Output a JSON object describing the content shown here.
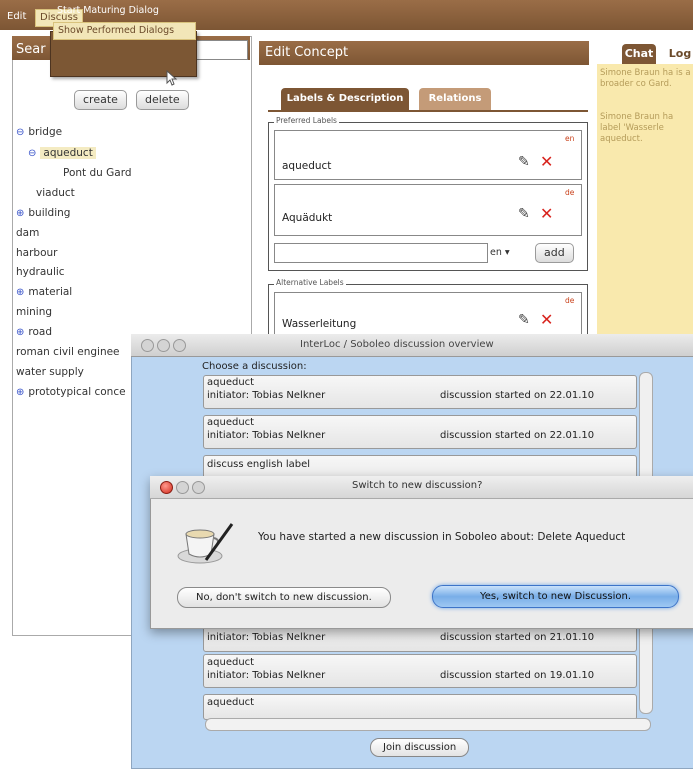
{
  "menubar": {
    "edit_label": "Edit",
    "discuss_label": "Discuss"
  },
  "discuss_menu": {
    "items": [
      "Start Maturing Dialog",
      "Show Performed Dialogs"
    ]
  },
  "left_panel": {
    "header_label": "Sear",
    "create_label": "create",
    "delete_label": "delete",
    "tree": [
      {
        "label": "bridge",
        "icon": "minus"
      },
      {
        "label": "aqueduct",
        "icon": "minus"
      },
      {
        "label": "Pont du Gard",
        "icon": ""
      },
      {
        "label": "viaduct",
        "icon": ""
      },
      {
        "label": "building",
        "icon": "plus"
      },
      {
        "label": "dam",
        "icon": ""
      },
      {
        "label": "harbour",
        "icon": ""
      },
      {
        "label": "hydraulic",
        "icon": ""
      },
      {
        "label": "material",
        "icon": "plus"
      },
      {
        "label": "mining",
        "icon": ""
      },
      {
        "label": "road",
        "icon": "plus"
      },
      {
        "label": "roman civil enginee",
        "icon": ""
      },
      {
        "label": "water supply",
        "icon": ""
      },
      {
        "label": "prototypical conce",
        "icon": "plus"
      }
    ]
  },
  "edit_concept": {
    "title": "Edit Concept",
    "tabs": [
      "Labels & Description",
      "Relations"
    ],
    "preferred_legend": "Preferred Labels",
    "preferred_labels": [
      {
        "lang": "en",
        "text": "aqueduct"
      },
      {
        "lang": "de",
        "text": "Aquädukt"
      }
    ],
    "new_label_lang": "en",
    "add_label": "add",
    "alternative_legend": "Alternative Labels",
    "alternative_labels": [
      {
        "lang": "de",
        "text": "Wasserleitung"
      }
    ]
  },
  "right_panel": {
    "tabs": [
      "Chat",
      "Log"
    ],
    "messages": [
      "Simone Braun ha is a broader co Gard.",
      "Simone Braun ha label 'Wasserle aqueduct."
    ]
  },
  "interloc": {
    "title": "InterLoc / Soboleo discussion overview",
    "choose_label": "Choose a discussion:",
    "discussions": [
      {
        "topic": "aqueduct",
        "initiator": "initiator: Tobias Nelkner",
        "started": "discussion started on 22.01.10"
      },
      {
        "topic": "aqueduct",
        "initiator": "initiator: Tobias Nelkner",
        "started": "discussion started on 22.01.10"
      },
      {
        "topic": "discuss english label",
        "initiator": "",
        "started": ""
      },
      {
        "topic": "aqueduct",
        "initiator": "initiator: Tobias Nelkner",
        "started": "discussion started on 21.01.10"
      },
      {
        "topic": "aqueduct",
        "initiator": "initiator: Tobias Nelkner",
        "started": "discussion started on 19.01.10"
      },
      {
        "topic": "aqueduct",
        "initiator": "",
        "started": ""
      }
    ],
    "join_label": "Join discussion"
  },
  "switch_dialog": {
    "title": "Switch to new discussion?",
    "message": "You have started a new discussion in Soboleo about: Delete Aqueduct",
    "no_label": "No, don't switch to new discussion.",
    "yes_label": "Yes, switch to new Discussion."
  },
  "colors": {
    "brown": "#7d5634",
    "cream": "#f9e9ad",
    "delete_red": "#d8231d",
    "dialog_blue": "#bbd6f2"
  }
}
